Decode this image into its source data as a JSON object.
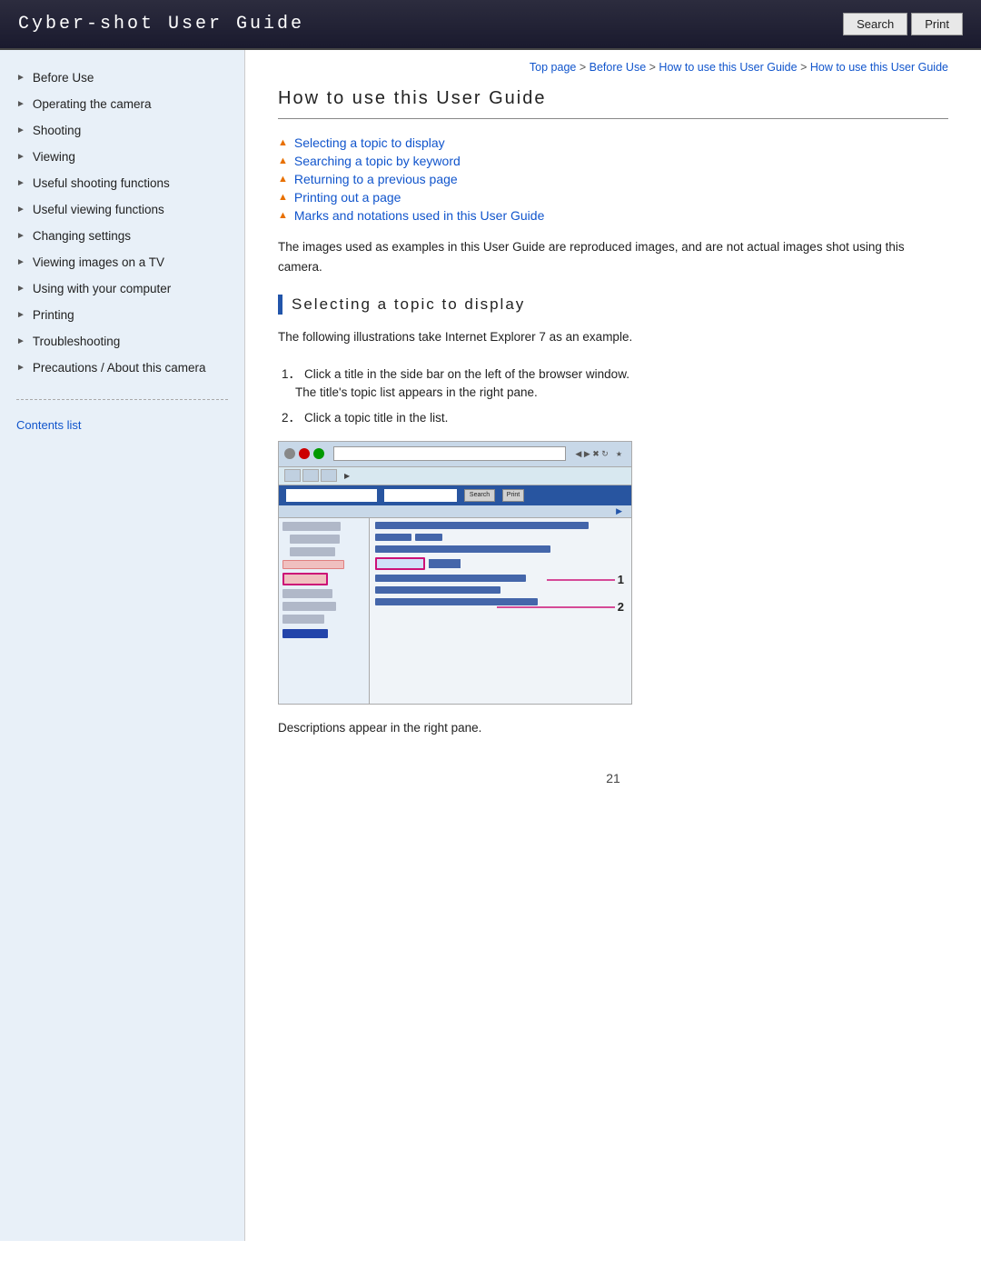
{
  "header": {
    "title": "Cyber-shot User Guide",
    "search_label": "Search",
    "print_label": "Print"
  },
  "breadcrumb": {
    "items": [
      "Top page",
      "Before Use",
      "How to use this User Guide",
      "How to use this User Guide"
    ],
    "separator": " > "
  },
  "page_title": "How to use this User Guide",
  "links": [
    {
      "label": "Selecting a topic to display"
    },
    {
      "label": "Searching a topic by keyword"
    },
    {
      "label": "Returning to a previous page"
    },
    {
      "label": "Printing out a page"
    },
    {
      "label": "Marks and notations used in this User Guide"
    }
  ],
  "intro_text": "The images used as examples in this User Guide are reproduced images, and are not actual images shot using this camera.",
  "section_heading": "Selecting a topic to display",
  "section_intro": "The following illustrations take Internet Explorer 7 as an example.",
  "steps": [
    {
      "num": "1．",
      "text": "Click a title in the side bar on the left of the browser window.\nThe title's topic list appears in the right pane."
    },
    {
      "num": "2．",
      "text": "Click a topic title in the list."
    }
  ],
  "bottom_text": "Descriptions appear in the right pane.",
  "sidebar": {
    "items": [
      "Before Use",
      "Operating the camera",
      "Shooting",
      "Viewing",
      "Useful shooting functions",
      "Useful viewing functions",
      "Changing settings",
      "Viewing images on a TV",
      "Using with your computer",
      "Printing",
      "Troubleshooting",
      "Precautions / About this camera"
    ],
    "contents_link": "Contents list"
  },
  "page_number": "21"
}
